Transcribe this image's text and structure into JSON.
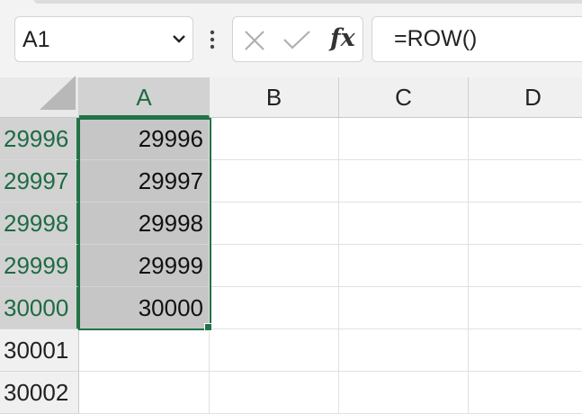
{
  "name_box": {
    "value": "A1"
  },
  "formula_bar": {
    "fx_label": "fx",
    "formula": "=ROW()"
  },
  "columns": [
    "A",
    "B",
    "C",
    "D"
  ],
  "selected_column": "A",
  "rows": [
    {
      "header": "29996",
      "a": "29996",
      "selected": true
    },
    {
      "header": "29997",
      "a": "29997",
      "selected": true
    },
    {
      "header": "29998",
      "a": "29998",
      "selected": true
    },
    {
      "header": "29999",
      "a": "29999",
      "selected": true
    },
    {
      "header": "30000",
      "a": "30000",
      "selected": true
    },
    {
      "header": "30001",
      "a": "",
      "selected": false
    },
    {
      "header": "30002",
      "a": "",
      "selected": false
    }
  ],
  "colors": {
    "accent": "#217346",
    "selected_fill": "#c6c6c6",
    "header_fill": "#f0f0f0"
  },
  "icons": [
    "chevron-down-icon",
    "more-options-icon",
    "cancel-icon",
    "enter-icon",
    "insert-function-icon",
    "select-all-triangle-icon"
  ]
}
